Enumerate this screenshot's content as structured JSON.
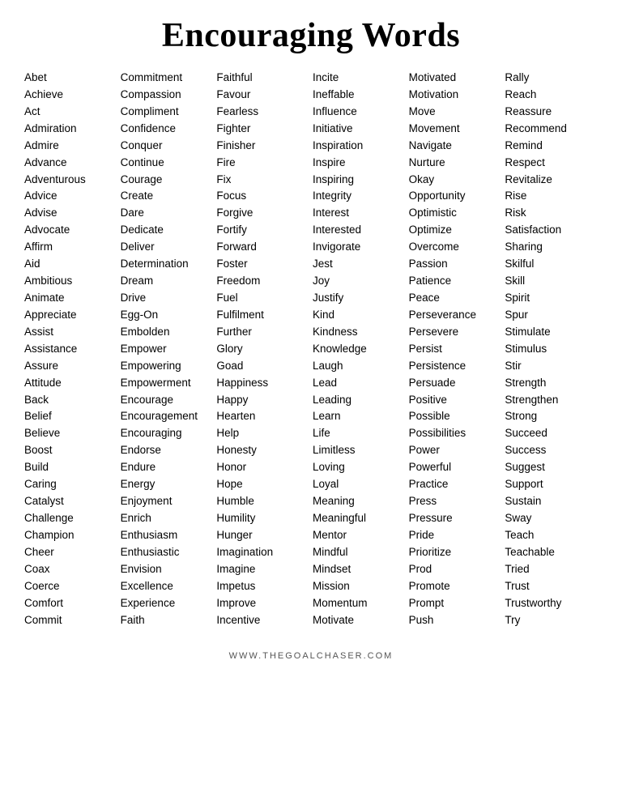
{
  "title": "Encouraging Words",
  "columns": [
    [
      "Abet",
      "Achieve",
      "Act",
      "Admiration",
      "Admire",
      "Advance",
      "Adventurous",
      "Advice",
      "Advise",
      "Advocate",
      "Affirm",
      "Aid",
      "Ambitious",
      "Animate",
      "Appreciate",
      "Assist",
      "Assistance",
      "Assure",
      "Attitude",
      "Back",
      "Belief",
      "Believe",
      "Boost",
      "Build",
      "Caring",
      "Catalyst",
      "Challenge",
      "Champion",
      "Cheer",
      "Coax",
      "Coerce",
      "Comfort",
      "Commit"
    ],
    [
      "Commitment",
      "Compassion",
      "Compliment",
      "Confidence",
      "Conquer",
      "Continue",
      "Courage",
      "Create",
      "Dare",
      "Dedicate",
      "Deliver",
      "Determination",
      "Dream",
      "Drive",
      "Egg-On",
      "Embolden",
      "Empower",
      "Empowering",
      "Empowerment",
      "Encourage",
      "Encouragement",
      "Encouraging",
      "Endorse",
      "Endure",
      "Energy",
      "Enjoyment",
      "Enrich",
      "Enthusiasm",
      "Enthusiastic",
      "Envision",
      "Excellence",
      "Experience",
      "Faith"
    ],
    [
      "Faithful",
      "Favour",
      "Fearless",
      "Fighter",
      "Finisher",
      "Fire",
      "Fix",
      "Focus",
      "Forgive",
      "Fortify",
      "Forward",
      "Foster",
      "Freedom",
      "Fuel",
      "Fulfilment",
      "Further",
      "Glory",
      "Goad",
      "Happiness",
      "Happy",
      "Hearten",
      "Help",
      "Honesty",
      "Honor",
      "Hope",
      "Humble",
      "Humility",
      "Hunger",
      "Imagination",
      "Imagine",
      "Impetus",
      "Improve",
      "Incentive"
    ],
    [
      "Incite",
      "Ineffable",
      "Influence",
      "Initiative",
      "Inspiration",
      "Inspire",
      "Inspiring",
      "Integrity",
      "Interest",
      "Interested",
      "Invigorate",
      "Jest",
      "Joy",
      "Justify",
      "Kind",
      "Kindness",
      "Knowledge",
      "Laugh",
      "Lead",
      "Leading",
      "Learn",
      "Life",
      "Limitless",
      "Loving",
      "Loyal",
      "Meaning",
      "Meaningful",
      "Mentor",
      "Mindful",
      "Mindset",
      "Mission",
      "Momentum",
      "Motivate"
    ],
    [
      "Motivated",
      "Motivation",
      "Move",
      "Movement",
      "Navigate",
      "Nurture",
      "Okay",
      "Opportunity",
      "Optimistic",
      "Optimize",
      "Overcome",
      "Passion",
      "Patience",
      "Peace",
      "Perseverance",
      "Persevere",
      "Persist",
      "Persistence",
      "Persuade",
      "Positive",
      "Possible",
      "Possibilities",
      "Power",
      "Powerful",
      "Practice",
      "Press",
      "Pressure",
      "Pride",
      "Prioritize",
      "Prod",
      "Promote",
      "Prompt",
      "Push"
    ],
    [
      "Rally",
      "Reach",
      "Reassure",
      "Recommend",
      "Remind",
      "Respect",
      "Revitalize",
      "Rise",
      "Risk",
      "Satisfaction",
      "Sharing",
      "Skilful",
      "Skill",
      "Spirit",
      "Spur",
      "Stimulate",
      "Stimulus",
      "Stir",
      "Strength",
      "Strengthen",
      "Strong",
      "Succeed",
      "Success",
      "Suggest",
      "Support",
      "Sustain",
      "Sway",
      "Teach",
      "Teachable",
      "Tried",
      "Trust",
      "Trustworthy",
      "Try"
    ]
  ],
  "footer": "WWW.THEGOALCHASER.COM"
}
